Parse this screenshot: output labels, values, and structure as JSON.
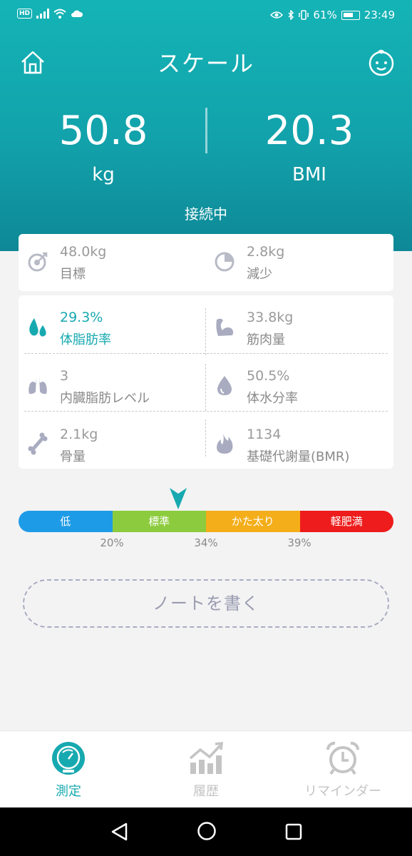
{
  "status": {
    "hd": "HD",
    "battery_pct": "61%",
    "time": "23:49"
  },
  "header": {
    "title": "スケール"
  },
  "metrics": {
    "weight": {
      "value": "50.8",
      "unit": "kg"
    },
    "bmi": {
      "value": "20.3",
      "unit": "BMI"
    },
    "connection": "接続中"
  },
  "goal_card": {
    "target": {
      "value": "48.0kg",
      "label": "目標",
      "icon": "target-icon"
    },
    "decrease": {
      "value": "2.8kg",
      "label": "減少",
      "icon": "pie-icon"
    }
  },
  "body_stats": [
    {
      "value": "29.3%",
      "label": "体脂肪率",
      "icon": "droplets-icon",
      "highlight": true
    },
    {
      "value": "33.8kg",
      "label": "筋肉量",
      "icon": "muscle-arm-icon",
      "highlight": false
    },
    {
      "value": "3",
      "label": "内臓脂肪レベル",
      "icon": "lungs-icon",
      "highlight": false
    },
    {
      "value": "50.5%",
      "label": "体水分率",
      "icon": "water-drop-icon",
      "highlight": false
    },
    {
      "value": "2.1kg",
      "label": "骨量",
      "icon": "bone-icon",
      "highlight": false
    },
    {
      "value": "1134",
      "label": "基礎代謝量(BMR)",
      "icon": "flame-icon",
      "highlight": false
    }
  ],
  "range_bar": {
    "segments": [
      {
        "label": "低",
        "color": "#1e9be6"
      },
      {
        "label": "標準",
        "color": "#8ccb3d"
      },
      {
        "label": "かた太り",
        "color": "#f4ae1a"
      },
      {
        "label": "軽肥満",
        "color": "#ee1c1c"
      }
    ],
    "ticks": [
      "20%",
      "34%",
      "39%"
    ],
    "pointer_color": "#17a9b0"
  },
  "note_button": "ノートを書く",
  "tabs": [
    {
      "label": "測定",
      "icon": "gauge-icon",
      "active": true
    },
    {
      "label": "履歴",
      "icon": "trend-chart-icon",
      "active": false
    },
    {
      "label": "リマインダー",
      "icon": "alarm-clock-icon",
      "active": false
    }
  ],
  "colors": {
    "accent": "#17a9b0",
    "inactive": "#c4c4c4",
    "muted_icon": "#a9acc0"
  }
}
